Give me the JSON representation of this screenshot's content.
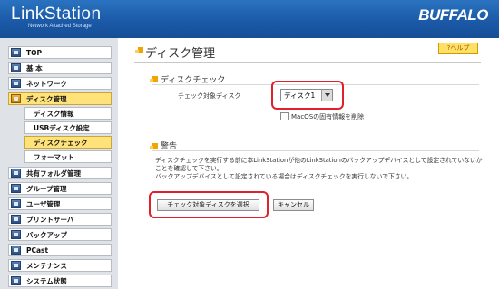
{
  "header": {
    "logo": "LinkStation",
    "logo_sub": "Network Attached Storage",
    "brand": "BUFFALO"
  },
  "sidebar": {
    "items": [
      {
        "label": "TOP"
      },
      {
        "label": "基 本"
      },
      {
        "label": "ネットワーク"
      },
      {
        "label": "ディスク管理"
      },
      {
        "label": "共有フォルダ管理"
      },
      {
        "label": "グループ管理"
      },
      {
        "label": "ユーザ管理"
      },
      {
        "label": "プリントサーバ"
      },
      {
        "label": "バックアップ"
      },
      {
        "label": "PCast"
      },
      {
        "label": "メンテナンス"
      },
      {
        "label": "システム状態"
      }
    ],
    "subitems": [
      {
        "label": "ディスク情報"
      },
      {
        "label": "USBディスク設定"
      },
      {
        "label": "ディスクチェック"
      },
      {
        "label": "フォーマット"
      }
    ]
  },
  "main": {
    "title": "ディスク管理",
    "help": "?ヘルプ",
    "disk_check": {
      "section_title": "ディスクチェック",
      "target_label": "チェック対象ディスク",
      "selected_disk": "ディスク1",
      "macos_label": "MacOSの固有情報を削除"
    },
    "warning": {
      "section_title": "警告",
      "line1": "ディスクチェックを実行する前に本LinkStationが他のLinkStationのバックアップデバイスとして設定されていないか",
      "line2": "ことを確認して下さい。",
      "line3": "バックアップデバイスとして設定されている場合はディスクチェックを実行しないで下さい。"
    },
    "buttons": {
      "select": "チェック対象ディスクを選択",
      "cancel": "キャンセル"
    }
  },
  "colors": {
    "header_blue": "#1b5aa8",
    "active_yellow": "#ffe27a",
    "highlight_red": "#e0202a",
    "bullet_orange": "#f0a500"
  }
}
